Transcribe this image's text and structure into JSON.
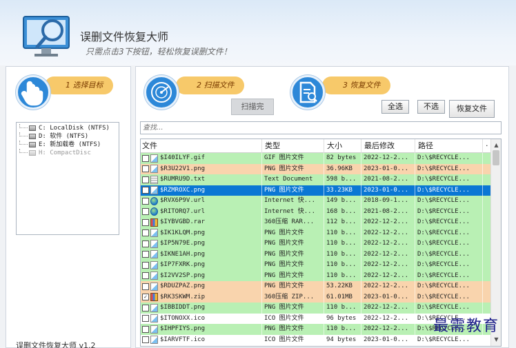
{
  "app": {
    "title": "误删文件恢复大师",
    "subtitle": "只需点击3下按钮，轻松恢复误删文件！",
    "version": "误删文件恢复大师 v1.2"
  },
  "steps": [
    {
      "label": "1 选择目标"
    },
    {
      "label": "2 扫描文件"
    },
    {
      "label": "3 恢复文件"
    }
  ],
  "buttons": {
    "scan": "扫描完",
    "select_all": "全选",
    "select_none": "不选",
    "recover": "恢复文件"
  },
  "search": {
    "placeholder": "查找..."
  },
  "drives": [
    {
      "label": "C: LocalDisk (NTFS)",
      "enabled": true
    },
    {
      "label": "D: 软件 (NTFS)",
      "enabled": true
    },
    {
      "label": "E: 新加载卷 (NTFS)",
      "enabled": true
    },
    {
      "label": "H: CompactDisc",
      "enabled": false
    }
  ],
  "table": {
    "columns": [
      "文件",
      "类型",
      "大小",
      "最后修改",
      "路径"
    ],
    "rows": [
      {
        "name": "$I40ILYF.gif",
        "type": "GIF 图片文件",
        "size": "82 bytes",
        "date": "2022-12-2...",
        "path": "D:\\$RECYCLE...",
        "color": "green",
        "checked": false,
        "icon": "pic"
      },
      {
        "name": "$R3U22V1.png",
        "type": "PNG 图片文件",
        "size": "36.96KB",
        "date": "2023-01-0...",
        "path": "D:\\$RECYCLE...",
        "color": "orange",
        "checked": false,
        "icon": "pic"
      },
      {
        "name": "$RUMRU9D.txt",
        "type": "Text Document",
        "size": "598 b...",
        "date": "2021-08-2...",
        "path": "D:\\$RECYCLE...",
        "color": "green",
        "checked": false,
        "icon": "txt"
      },
      {
        "name": "$RZMROXC.png",
        "type": "PNG 图片文件",
        "size": "33.23KB",
        "date": "2023-01-0...",
        "path": "D:\\$RECYCLE...",
        "color": "selected",
        "checked": false,
        "icon": "pic"
      },
      {
        "name": "$RVX6P9V.url",
        "type": "Internet 快...",
        "size": "149 b...",
        "date": "2018-09-1...",
        "path": "D:\\$RECYCLE...",
        "color": "green",
        "checked": false,
        "icon": "globe"
      },
      {
        "name": "$RITORQ7.url",
        "type": "Internet 快...",
        "size": "168 b...",
        "date": "2021-08-2...",
        "path": "D:\\$RECYCLE...",
        "color": "green",
        "checked": false,
        "icon": "globe"
      },
      {
        "name": "$IYBVGBD.rar",
        "type": "360压缩 RAR...",
        "size": "112 b...",
        "date": "2022-12-2...",
        "path": "D:\\$RECYCLE...",
        "color": "green",
        "checked": false,
        "icon": "archive"
      },
      {
        "name": "$IK1KLQM.png",
        "type": "PNG 图片文件",
        "size": "110 b...",
        "date": "2022-12-2...",
        "path": "D:\\$RECYCLE...",
        "color": "green",
        "checked": false,
        "icon": "pic"
      },
      {
        "name": "$IP5N79E.png",
        "type": "PNG 图片文件",
        "size": "110 b...",
        "date": "2022-12-2...",
        "path": "D:\\$RECYCLE...",
        "color": "green",
        "checked": false,
        "icon": "pic"
      },
      {
        "name": "$IKNE1AH.png",
        "type": "PNG 图片文件",
        "size": "110 b...",
        "date": "2022-12-2...",
        "path": "D:\\$RECYCLE...",
        "color": "green",
        "checked": false,
        "icon": "pic"
      },
      {
        "name": "$IP7FXRK.png",
        "type": "PNG 图片文件",
        "size": "110 b...",
        "date": "2022-12-2...",
        "path": "D:\\$RECYCLE...",
        "color": "green",
        "checked": false,
        "icon": "pic"
      },
      {
        "name": "$I2VV2SP.png",
        "type": "PNG 图片文件",
        "size": "110 b...",
        "date": "2022-12-2...",
        "path": "D:\\$RECYCLE...",
        "color": "green",
        "checked": false,
        "icon": "pic"
      },
      {
        "name": "$RDUZPAZ.png",
        "type": "PNG 图片文件",
        "size": "53.22KB",
        "date": "2022-12-2...",
        "path": "D:\\$RECYCLE...",
        "color": "orange",
        "checked": false,
        "icon": "pic"
      },
      {
        "name": "$RK3SKWM.zip",
        "type": "360压缩 ZIP...",
        "size": "61.01MB",
        "date": "2023-01-0...",
        "path": "D:\\$RECYCLE...",
        "color": "orange",
        "checked": true,
        "icon": "archive"
      },
      {
        "name": "$IBBIDDT.png",
        "type": "PNG 图片文件",
        "size": "110 b...",
        "date": "2022-12-2...",
        "path": "D:\\$RECYCLE...",
        "color": "green",
        "checked": false,
        "icon": "pic"
      },
      {
        "name": "$ITONOXX.ico",
        "type": "ICO 图片文件",
        "size": "96 bytes",
        "date": "2022-12-2...",
        "path": "D:\\$RECYCLE...",
        "color": "white",
        "checked": false,
        "icon": "pic"
      },
      {
        "name": "$IHPFIYS.png",
        "type": "PNG 图片文件",
        "size": "110 b...",
        "date": "2022-12-2...",
        "path": "D:\\$RECYCLE...",
        "color": "green",
        "checked": false,
        "icon": "pic"
      },
      {
        "name": "$IARVFTF.ico",
        "type": "ICO 图片文件",
        "size": "94 bytes",
        "date": "2023-01-0...",
        "path": "D:\\$RECYCLE...",
        "color": "white",
        "checked": false,
        "icon": "pic"
      }
    ]
  },
  "watermark": "最需教育",
  "colors": {
    "accent": "#2d88d8",
    "pill": "#f7c96a",
    "row_green": "#b9f0b4",
    "row_orange": "#f9d4ad",
    "row_selected": "#0a77d4"
  }
}
